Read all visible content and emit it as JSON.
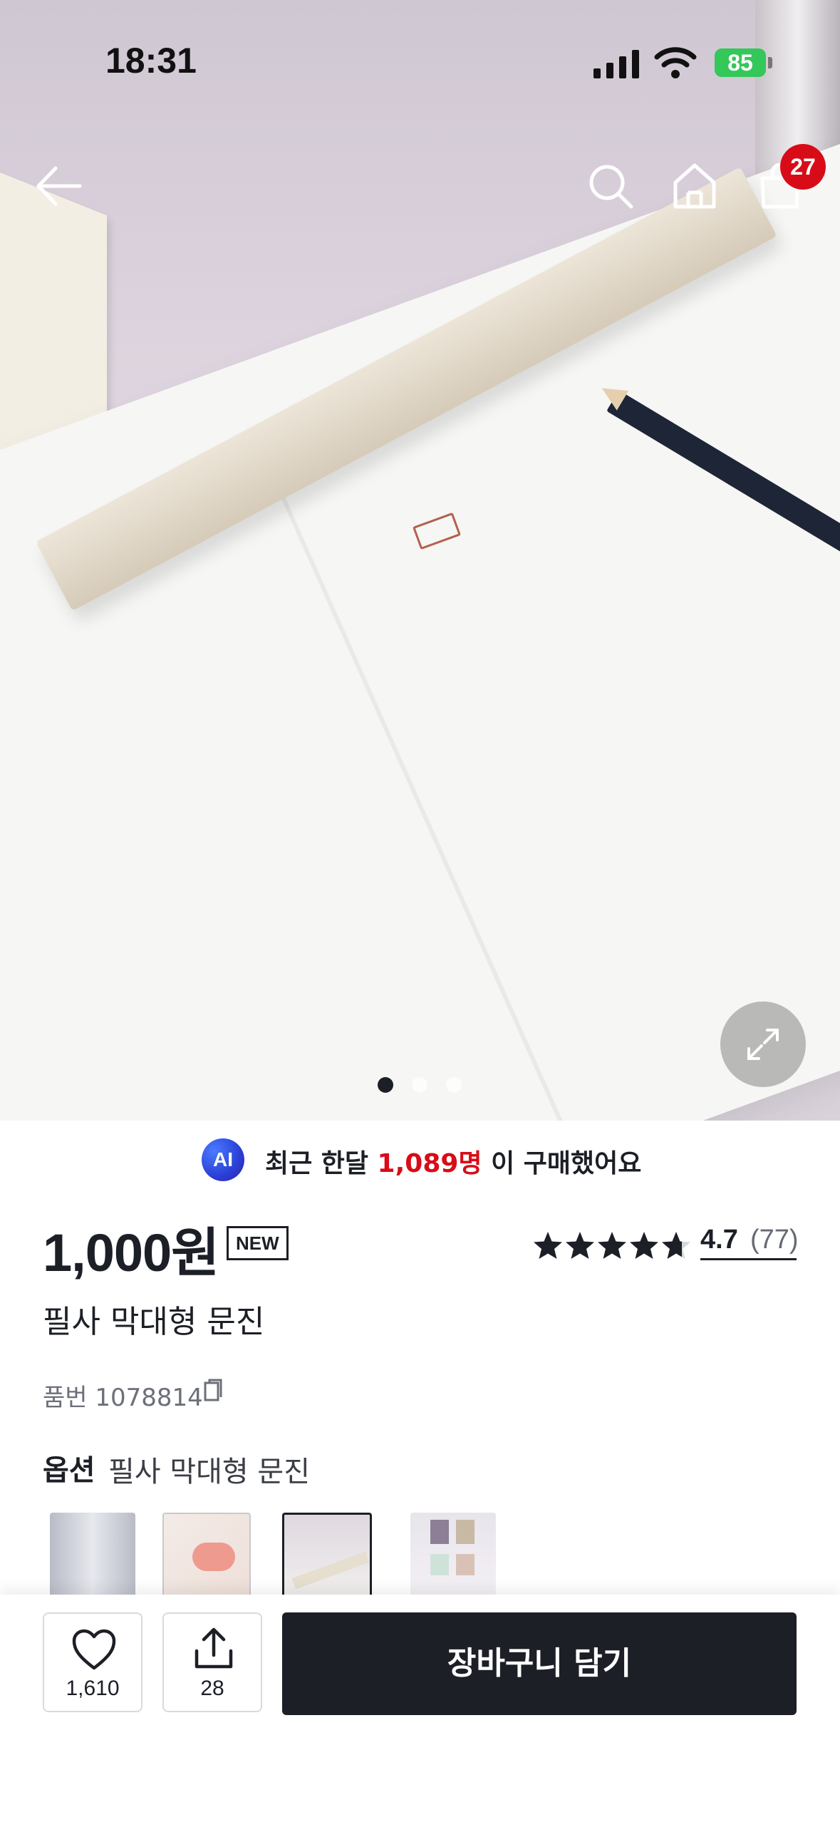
{
  "status_bar": {
    "time": "18:31",
    "battery": "85"
  },
  "nav": {
    "cart_count": "27"
  },
  "gallery": {
    "pages": 3,
    "current": 1
  },
  "ai": {
    "badge": "AI",
    "prefix": "최근 한달 ",
    "count": "1,089명",
    "suffix": " 이 구매했어요"
  },
  "product": {
    "price": "1,000원",
    "badge": "NEW",
    "rating": "4.7",
    "rating_count": "(77)",
    "stars_filled": 4.7,
    "title": "필사 막대형 문진",
    "sku": "품번 1078814"
  },
  "option": {
    "label": "옵션",
    "value": "필사 막대형 문진"
  },
  "bottom": {
    "likes": "1,610",
    "shares": "28",
    "cart_button": "장바구니 담기"
  },
  "colors": {
    "accent_red": "#d80c18",
    "dark": "#1c1f26",
    "battery_green": "#34c759"
  }
}
